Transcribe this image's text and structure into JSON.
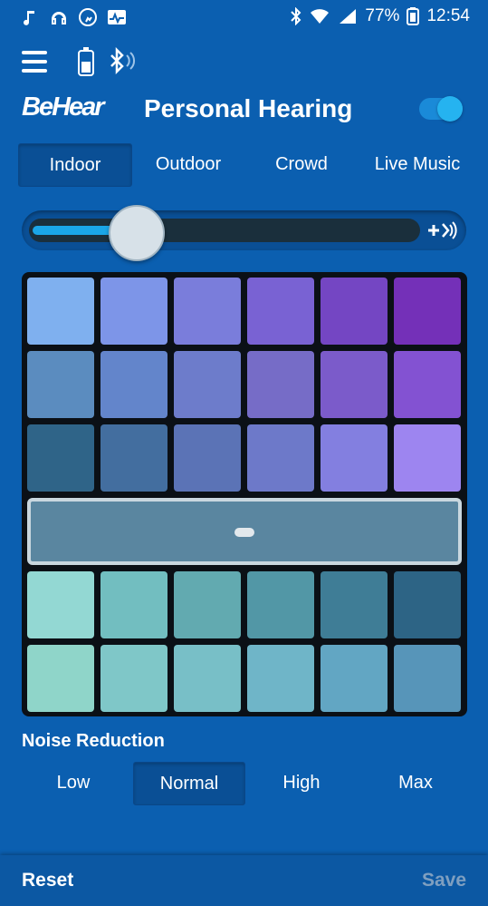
{
  "status_bar": {
    "battery_percent": "77%",
    "time": "12:54",
    "left_icons": [
      "music-note-icon",
      "headphones-icon",
      "running-icon",
      "activity-icon"
    ],
    "right_icons": [
      "bluetooth-icon",
      "wifi-icon",
      "signal-icon",
      "battery-saver-icon"
    ]
  },
  "header": {
    "logo": "BeHear",
    "title": "Personal Hearing",
    "toggle_on": true
  },
  "tabs": {
    "items": [
      "Indoor",
      "Outdoor",
      "Crowd",
      "Live Music"
    ],
    "active_index": 0
  },
  "volume": {
    "level": 0.27
  },
  "tuning_grid": {
    "rows": [
      [
        "#7fb0ef",
        "#7d95e8",
        "#7a7ddb",
        "#7962d3",
        "#7446c3",
        "#7430b8"
      ],
      [
        "#5b8cbf",
        "#6385cb",
        "#6d7ccb",
        "#766cc7",
        "#7b5bca",
        "#8352d2"
      ],
      [
        "#2f6488",
        "#436e9f",
        "#5b73b6",
        "#6d79c9",
        "#837fe0",
        "#9d85f0"
      ],
      [
        "#93d8d3",
        "#72bec0",
        "#62aab0",
        "#5297a6",
        "#3f7d96",
        "#2d6485"
      ],
      [
        "#8fd5c9",
        "#7fc7c8",
        "#78bfc7",
        "#6fb5c8",
        "#62a6c3",
        "#5795b9"
      ]
    ]
  },
  "noise_reduction": {
    "label": "Noise Reduction",
    "options": [
      "Low",
      "Normal",
      "High",
      "Max"
    ],
    "active_index": 1
  },
  "footer": {
    "reset_label": "Reset",
    "save_label": "Save"
  }
}
